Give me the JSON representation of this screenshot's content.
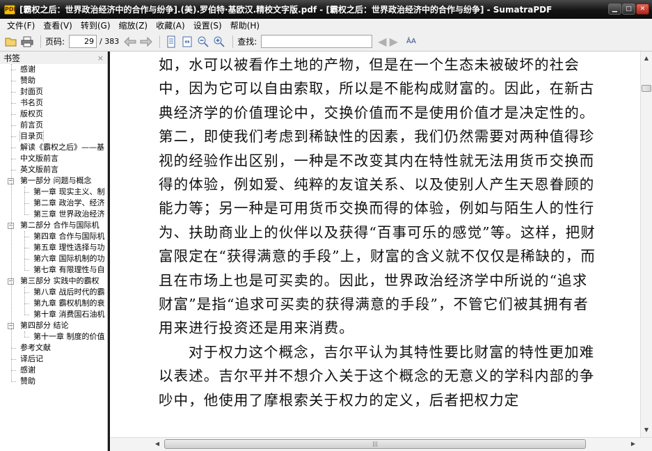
{
  "window": {
    "title": "[霸权之后：世界政治经济中的合作与纷争].(美).罗伯特·基欧汉.精校文字版.pdf - [霸权之后：世界政治经济中的合作与纷争] - SumatraPDF",
    "app_icon_text": "PDF"
  },
  "menu": [
    "文件(F)",
    "查看(V)",
    "转到(G)",
    "缩放(Z)",
    "收藏(A)",
    "设置(S)",
    "帮助(H)"
  ],
  "toolbar": {
    "page_label": "页码:",
    "page_value": "29",
    "page_total": "/ 383",
    "find_label": "查找:",
    "find_value": "",
    "match_case": "ÂA"
  },
  "sidebar": {
    "title": "书签",
    "close": "×",
    "items": [
      {
        "label": "感谢",
        "level": 0
      },
      {
        "label": "赞助",
        "level": 0
      },
      {
        "label": "封面页",
        "level": 0
      },
      {
        "label": "书名页",
        "level": 0
      },
      {
        "label": "版权页",
        "level": 0
      },
      {
        "label": "前言页",
        "level": 0
      },
      {
        "label": "目录页",
        "level": 0,
        "selected": true
      },
      {
        "label": "解读《霸权之后》——基",
        "level": 0
      },
      {
        "label": "中文版前言",
        "level": 0
      },
      {
        "label": "英文版前言",
        "level": 0
      },
      {
        "label": "第一部分 问题与概念",
        "level": 0,
        "expander": "−"
      },
      {
        "label": "第一章 现实主义、制",
        "level": 1
      },
      {
        "label": "第二章 政治学、经济",
        "level": 1
      },
      {
        "label": "第三章 世界政治经济",
        "level": 1
      },
      {
        "label": "第二部分 合作与国际机",
        "level": 0,
        "expander": "−"
      },
      {
        "label": "第四章 合作与国际机",
        "level": 1
      },
      {
        "label": "第五章 理性选择与功",
        "level": 1
      },
      {
        "label": "第六章 国际机制的功",
        "level": 1
      },
      {
        "label": "第七章 有限理性与自",
        "level": 1
      },
      {
        "label": "第三部分 实践中的霸权",
        "level": 0,
        "expander": "−"
      },
      {
        "label": "第八章 战后时代的霸",
        "level": 1
      },
      {
        "label": "第九章 霸权机制的衰",
        "level": 1
      },
      {
        "label": "第十章 消费国石油机",
        "level": 1
      },
      {
        "label": "第四部分 结论",
        "level": 0,
        "expander": "−"
      },
      {
        "label": "第十一章 制度的价值",
        "level": 1
      },
      {
        "label": "参考文献",
        "level": 0
      },
      {
        "label": "译后记",
        "level": 0
      },
      {
        "label": "感谢",
        "level": 0
      },
      {
        "label": "赞助",
        "level": 0
      }
    ]
  },
  "document": {
    "paragraphs": [
      {
        "indent": false,
        "text": "如，水可以被看作土地的产物，但是在一个生态未被破坏的社会中，因为它可以自由索取，所以是不能构成财富的。因此，在新古典经济学的价值理论中，交换价值而不是使用价值才是决定性的。第二，即使我们考虑到稀缺性的因素，我们仍然需要对两种值得珍视的经验作出区别，一种是不改变其内在特性就无法用货币交换而得的体验，例如爱、纯粹的友谊关系、以及使别人产生天恩眷顾的能力等；另一种是可用货币交换而得的体验，例如与陌生人的性行为、扶助商业上的伙伴以及获得“百事可乐的感觉”等。这样，把财富限定在“获得满意的手段”上，财富的含义就不仅仅是稀缺的，而且在市场上也是可买卖的。因此，世界政治经济学中所说的“追求财富”是指“追求可买卖的获得满意的手段”，不管它们被其拥有者用来进行投资还是用来消费。"
      },
      {
        "indent": true,
        "text": "对于权力这个概念，吉尔平认为其特性要比财富的特性更加难以表述。吉尔平并不想介入关于这个概念的无意义的学科内部的争吵中，他使用了摩根索关于权力的定义，后者把权力定"
      }
    ]
  },
  "colors": {
    "titlebar": "#141414",
    "chrome": "#f0f0f0",
    "page": "#ffffff"
  }
}
